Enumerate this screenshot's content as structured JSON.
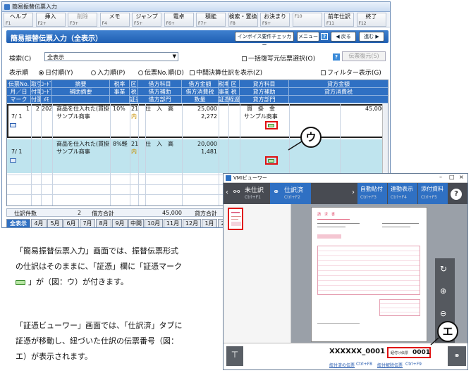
{
  "window": {
    "title": "簡易振替伝票入力"
  },
  "fkeys": [
    {
      "label": "ヘルプ",
      "key": "F1"
    },
    {
      "label": "挿入",
      "key": "F2+"
    },
    {
      "label": "削除",
      "key": "F3+"
    },
    {
      "label": "メモ",
      "key": "F4"
    },
    {
      "label": "ジャンプ",
      "key": "F5+"
    },
    {
      "label": "電卓",
      "key": "F6+"
    },
    {
      "label": "積能",
      "key": "F7+"
    },
    {
      "label": "検索・置換",
      "key": "F8"
    },
    {
      "label": "お決まり",
      "key": "F9+"
    },
    {
      "label": "",
      "key": "F10"
    },
    {
      "label": "前年仕訳",
      "key": "F11"
    },
    {
      "label": "終了",
      "key": "F12"
    }
  ],
  "header": {
    "title": "簡易振替伝票入力（全表示）",
    "checker": "インボイス要件チェッカー",
    "menu": "メニュー",
    "prev": "◀ 戻る",
    "next": "進む ▶"
  },
  "filter": {
    "search_label": "検索(C)",
    "search_value": "全表示",
    "bulk_label": "一括復写元伝票選択(O)",
    "restore": "伝票復元(S)",
    "order_label": "表示順",
    "order_options": [
      "日付順(Y)",
      "入力順(P)",
      "伝票No.順(D)"
    ],
    "midterm": "中間決算仕訳を表示(Z)",
    "filter_show": "フィルター表示(G)"
  },
  "table": {
    "headers": [
      [
        "伝票No.",
        "月／日",
        "マーク"
      ],
      [
        "取引",
        "付箋1",
        "付箋2"
      ],
      [
        "ｺｰﾄﾞ",
        "ｺｰﾄﾞ",
        "ﾒﾓ"
      ],
      [
        "摘要",
        "補助摘要",
        ""
      ],
      [
        "税率",
        "事業",
        ""
      ],
      [
        "区",
        "税",
        "証憑"
      ],
      [
        "借方科目",
        "借方補助",
        "借方部門"
      ],
      [
        "借方金額",
        "借方消費税",
        "数量"
      ],
      [
        "税率",
        "事業",
        "証憑"
      ],
      [
        "区",
        "税",
        "経過"
      ],
      [
        "貸方科目",
        "貸方補助",
        "貸方部門"
      ],
      [
        "貸方金額",
        "貸方消費税",
        ""
      ]
    ],
    "rows": [
      {
        "no": "1",
        "date": "7/ 1",
        "torihiki": "2",
        "code": "202",
        "tekiyo": "商品を仕入れた(貫掛)",
        "hojo": "サンプル商事",
        "rate": "10%",
        "ku": "21",
        "zei": "内",
        "dr_account": "仕　入　高",
        "dr_amount": "25,000",
        "dr_tax": "2,272",
        "cr_account": "買　掛　金",
        "cr_hojo": "サンプル商事",
        "cr_amount": "45,000"
      },
      {
        "no": "",
        "date": "7/ 1",
        "torihiki": "",
        "code": "",
        "tekiyo": "商品を仕入れた(貫掛)",
        "hojo": "サンプル商事",
        "rate": "8%軽",
        "ku": "21",
        "zei": "内",
        "dr_account": "仕　入　高",
        "dr_amount": "20,000",
        "dr_tax": "1,481",
        "cr_account": "",
        "cr_hojo": "",
        "cr_amount": ""
      }
    ]
  },
  "footer": {
    "count_label": "仕訳件数",
    "count": "2",
    "debit_label": "借方合計",
    "debit_total": "45,000",
    "credit_label": "貸方合計"
  },
  "month_tabs": [
    "全表示",
    "4月",
    "5月",
    "6月",
    "7月",
    "8月",
    "9月",
    "中間",
    "10月",
    "11月",
    "12月",
    "1月",
    "2月"
  ],
  "viewer": {
    "title": "VMIビューワー",
    "tabs": [
      {
        "label": "未仕訳",
        "sub": "Ctrl+F1"
      },
      {
        "label": "仕訳済",
        "sub": "Ctrl+F2"
      },
      {
        "label": "自動貼付",
        "sub": "Ctrl+F3"
      },
      {
        "label": "連動表示",
        "sub": "Ctrl+F4"
      },
      {
        "label": "添付資料",
        "sub": "Ctrl+F5"
      }
    ],
    "slip_code": "XXXXXX_0001",
    "slip_label": "紐付け伝票",
    "slip_no": "0001",
    "bottom_links": [
      "紐付済の伝票",
      "Ctrl+F8",
      "紐付解除伝票",
      "Ctrl+F9"
    ],
    "doc_title": "請　求　書"
  },
  "callouts": {
    "u": "ウ",
    "e": "エ"
  },
  "description": [
    "「簡易振替伝票入力」画面では、振替伝票形式",
    "の仕訳はそのままに、「証憑」欄に「証憑マーク",
    "」が（図：ウ）が付きます。",
    "「証憑ビューワー」画面では、「仕訳済」タブに",
    "証憑が移動し、紐づいた仕訳の伝票番号（図：",
    "エ）が表示されます。"
  ]
}
